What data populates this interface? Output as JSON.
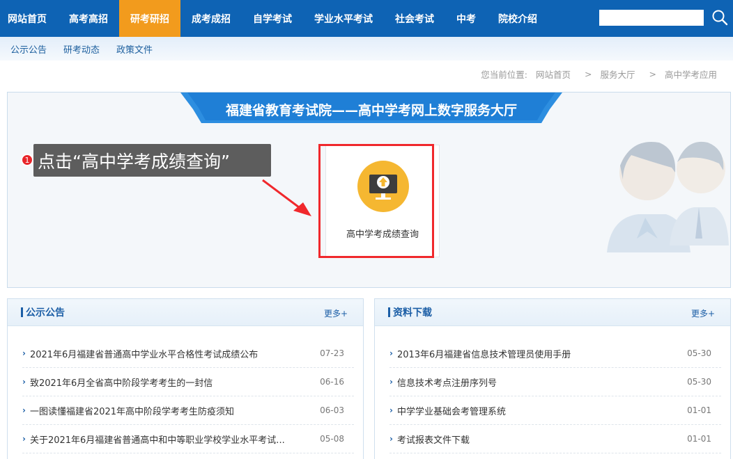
{
  "nav": {
    "items": [
      {
        "label": "网站首页",
        "active": false
      },
      {
        "label": "高考高招",
        "active": false
      },
      {
        "label": "研考研招",
        "active": true
      },
      {
        "label": "成考成招",
        "active": false
      },
      {
        "label": "自学考试",
        "active": false
      },
      {
        "label": "学业水平考试",
        "active": false
      },
      {
        "label": "社会考试",
        "active": false
      },
      {
        "label": "中考",
        "active": false
      },
      {
        "label": "院校介绍",
        "active": false
      }
    ],
    "search_value": ""
  },
  "subnav": [
    "公示公告",
    "研考动态",
    "政策文件"
  ],
  "breadcrumb": {
    "prefix": "您当前位置:",
    "items": [
      "网站首页",
      "服务大厅",
      "高中学考应用"
    ]
  },
  "hall": {
    "banner": "福建省教育考试院——高中学考网上数字服务大厅",
    "card_label": "高中学考成绩查询",
    "step_number": "1",
    "callout": "点击“高中学考成绩查询”"
  },
  "panels": [
    {
      "title": "公示公告",
      "more": "更多+",
      "items": [
        {
          "text": "2021年6月福建省普通高中学业水平合格性考试成绩公布",
          "date": "07-23"
        },
        {
          "text": "致2021年6月全省高中阶段学考考生的一封信",
          "date": "06-16"
        },
        {
          "text": "一图读懂福建省2021年高中阶段学考考生防疫须知",
          "date": "06-03"
        },
        {
          "text": "关于2021年6月福建省普通高中和中等职业学校学业水平考试...",
          "date": "05-08"
        }
      ]
    },
    {
      "title": "资料下载",
      "more": "更多+",
      "items": [
        {
          "text": "2013年6月福建省信息技术管理员使用手册",
          "date": "05-30"
        },
        {
          "text": "信息技术考点注册序列号",
          "date": "05-30"
        },
        {
          "text": "中学学业基础会考管理系统",
          "date": "01-01"
        },
        {
          "text": "考试报表文件下载",
          "date": "01-01"
        }
      ]
    }
  ],
  "colors": {
    "nav_bg": "#0e63b4",
    "nav_active": "#f29b1d",
    "highlight": "#f0282c",
    "accent": "#1b5ea6"
  }
}
